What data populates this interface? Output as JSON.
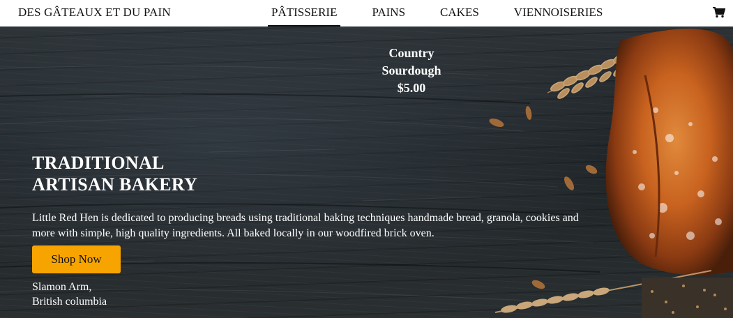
{
  "nav": {
    "brand": "DES GÂTEAUX ET DU PAIN",
    "items": [
      {
        "label": "PÂTISSERIE",
        "active": true
      },
      {
        "label": "PAINS",
        "active": false
      },
      {
        "label": "CAKES",
        "active": false
      },
      {
        "label": "VIENNOISERIES",
        "active": false
      }
    ],
    "cart_icon": "shopping-cart-icon"
  },
  "product": {
    "name_line1": "Country",
    "name_line2": "Sourdough",
    "price": "$5.00"
  },
  "hero": {
    "title_line1": "TRADITIONAL",
    "title_line2": "ARTISAN BAKERY",
    "description": "Little Red Hen is dedicated to producing breads using traditional baking techniques handmade bread, granola, cookies and more with simple, high quality ingredients. All baked locally in our woodfired brick oven.",
    "cta_label": "Shop Now",
    "address_line1": "Slamon Arm,",
    "address_line2": "British columbia"
  },
  "colors": {
    "accent": "#f7a400",
    "nav_bg": "#ffffff",
    "hero_text": "#ffffff"
  }
}
